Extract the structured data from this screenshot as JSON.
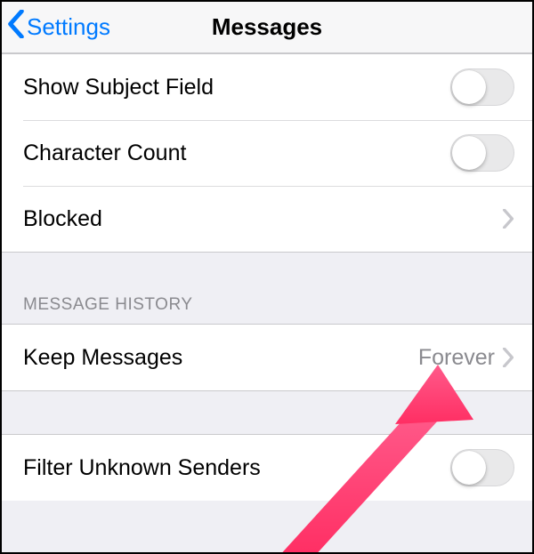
{
  "nav": {
    "back_label": "Settings",
    "title": "Messages"
  },
  "rows": {
    "show_subject": "Show Subject Field",
    "char_count": "Character Count",
    "blocked": "Blocked",
    "keep_messages": "Keep Messages",
    "keep_messages_value": "Forever",
    "filter_unknown": "Filter Unknown Senders"
  },
  "sections": {
    "history": "MESSAGE HISTORY"
  },
  "toggles": {
    "show_subject": false,
    "char_count": false,
    "filter_unknown": false
  }
}
